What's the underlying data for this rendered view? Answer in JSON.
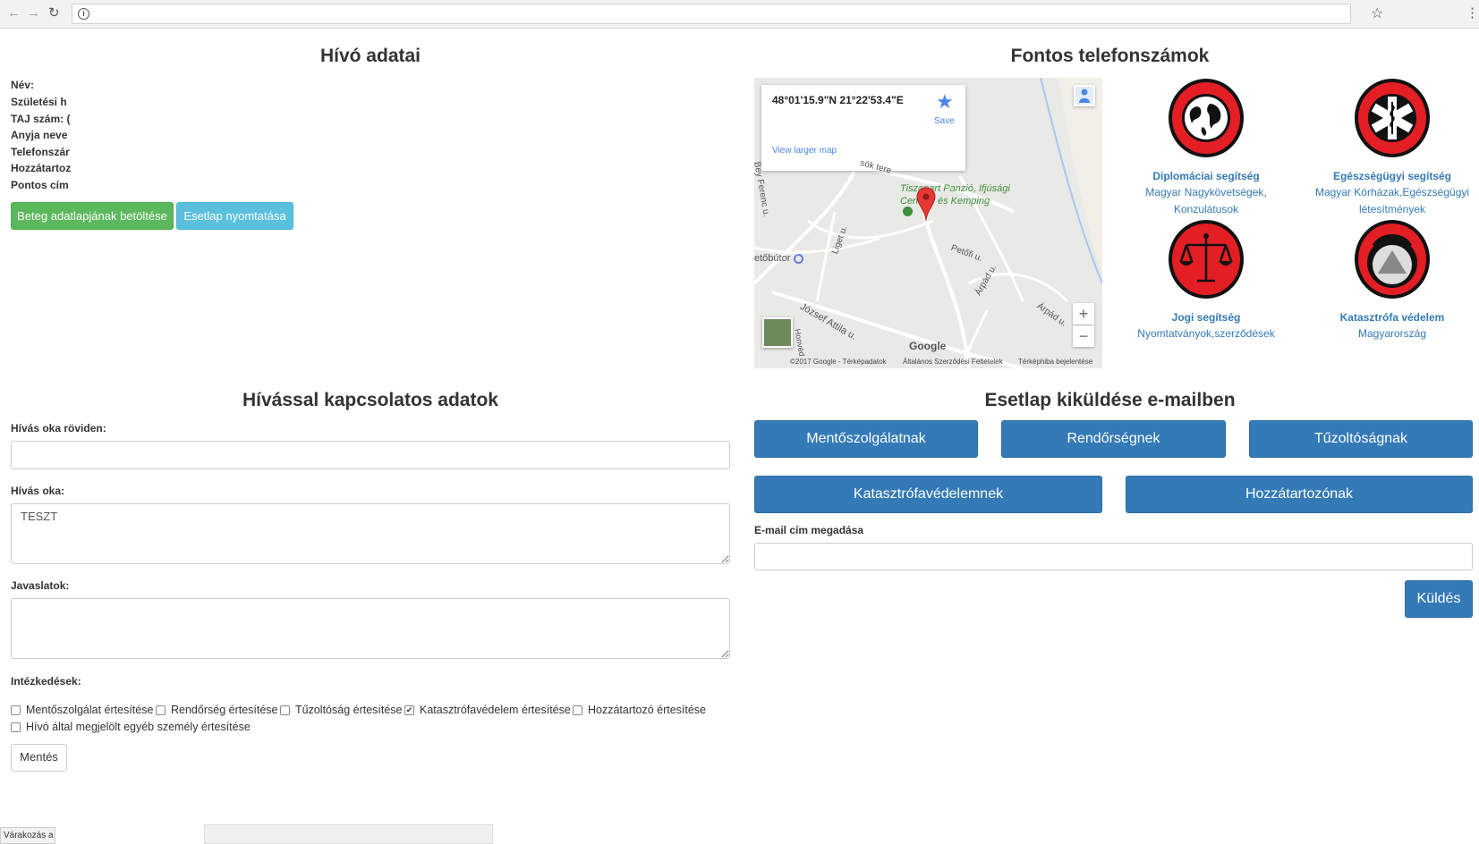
{
  "browser": {
    "info_icon": "i"
  },
  "caller": {
    "title": "Hívó adatai",
    "fields": [
      "Név:",
      "Születési h",
      "TAJ szám: (",
      "Anyja neve",
      "Telefonszár",
      "Hozzátartoz",
      "Pontos cím"
    ],
    "load_button": "Beteg adatlapjának betöltése",
    "print_button": "Esetlap nyomtatása"
  },
  "phones": {
    "title": "Fontos telefonszámok",
    "map": {
      "coords": "48°01'15.9\"N 21°22'53.4\"E",
      "save": "Save",
      "larger": "View larger map",
      "labels": {
        "place": "Tiszapart Panzió, Ifjúsági",
        "place2": "Cent",
        "place3": "és Kemping",
        "road1": "Bey Ferenc u.",
        "road2": "Liget u.",
        "road3": "Petőfi u.",
        "road4": "Árpád u.",
        "road5": "Árpád u.",
        "road6": "József Attila u.",
        "road7": "Honvéd",
        "road8": "sök tere",
        "shop": "etőbútor"
      },
      "logo": "Google",
      "footer": [
        "©2017 Google - Térképadatok",
        "Általános Szerződési Feltételek",
        "Térképhiba bejelentése"
      ]
    },
    "emblems": [
      {
        "title": "Diplomáciai segítség",
        "sub": [
          "Magyar Nagykövetségek,",
          "Konzulátusok"
        ],
        "icon": "globe-icon"
      },
      {
        "title": "Egészségügyi segítség",
        "sub": [
          "Magyar Kórházak,Egészségügyi",
          "létesítmények"
        ],
        "icon": "star-of-life-icon"
      },
      {
        "title": "Jogi segítség",
        "sub": [
          "Nyomtatványok,szerződések"
        ],
        "icon": "scales-icon"
      },
      {
        "title": "Katasztrófa védelem",
        "sub": [
          "Magyarország"
        ],
        "icon": "civil-defense-icon"
      }
    ]
  },
  "call": {
    "title": "Hívással kapcsolatos adatok",
    "reason_short_label": "Hívás oka röviden:",
    "reason_short_value": "",
    "reason_label": "Hívás oka:",
    "reason_value": "TESZT",
    "suggestions_label": "Javaslatok:",
    "suggestions_value": "",
    "actions_label": "Intézkedések:",
    "checkboxes": [
      {
        "label": "Mentőszolgálat értesítése",
        "checked": false
      },
      {
        "label": "Rendőrség értesítése",
        "checked": false
      },
      {
        "label": "Tűzoltóság értesítése",
        "checked": false
      },
      {
        "label": "Katasztrófavédelem értesítése",
        "checked": true
      },
      {
        "label": "Hozzátartozó értesítése",
        "checked": false
      },
      {
        "label": "Hívó által megjelölt egyéb személy értesítése",
        "checked": false
      }
    ],
    "save_button": "Mentés"
  },
  "email": {
    "title": "Esetlap kiküldése e-mailben",
    "buttons": [
      "Mentőszolgálatnak",
      "Rendőrségnek",
      "Tűzoltóságnak",
      "Katasztrófavédelemnek",
      "Hozzátartozónak"
    ],
    "address_label": "E-mail cím megadása",
    "address_value": "",
    "send_button": "Küldés"
  },
  "status": {
    "text": "Várakozás a s"
  },
  "colors": {
    "primary": "#337ab7",
    "success": "#5cb85c",
    "info": "#5bc0de",
    "emblem_red": "#e31e24"
  }
}
